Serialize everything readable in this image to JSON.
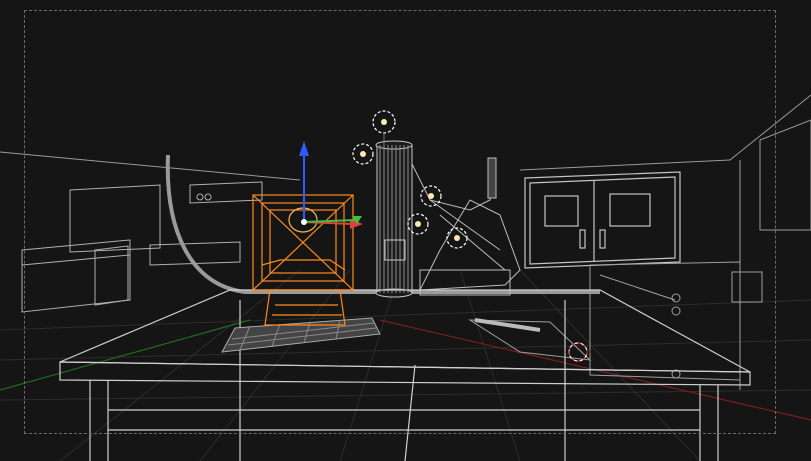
{
  "viewport": {
    "mode": "wireframe",
    "background": "#151515",
    "wire_color": "#bdbdbd",
    "selection_color": "#ff8a1a",
    "camera_view": true
  },
  "scene_objects": [
    {
      "name": "desk",
      "selected": false
    },
    {
      "name": "keyboard",
      "selected": false
    },
    {
      "name": "crt-monitor",
      "selected": true
    },
    {
      "name": "lab-cylinder",
      "selected": false
    },
    {
      "name": "robot-arm",
      "selected": false
    },
    {
      "name": "double-door",
      "selected": false
    },
    {
      "name": "wall-cabinet",
      "selected": false
    },
    {
      "name": "pipe",
      "selected": false
    }
  ],
  "gizmo": {
    "x_axis_color": "#e04040",
    "y_axis_color": "#40c040",
    "z_axis_color": "#2a5cff"
  },
  "lights": [
    {
      "name": "point-light-1"
    },
    {
      "name": "point-light-2"
    },
    {
      "name": "point-light-3"
    },
    {
      "name": "point-light-4"
    },
    {
      "name": "point-light-5"
    }
  ]
}
